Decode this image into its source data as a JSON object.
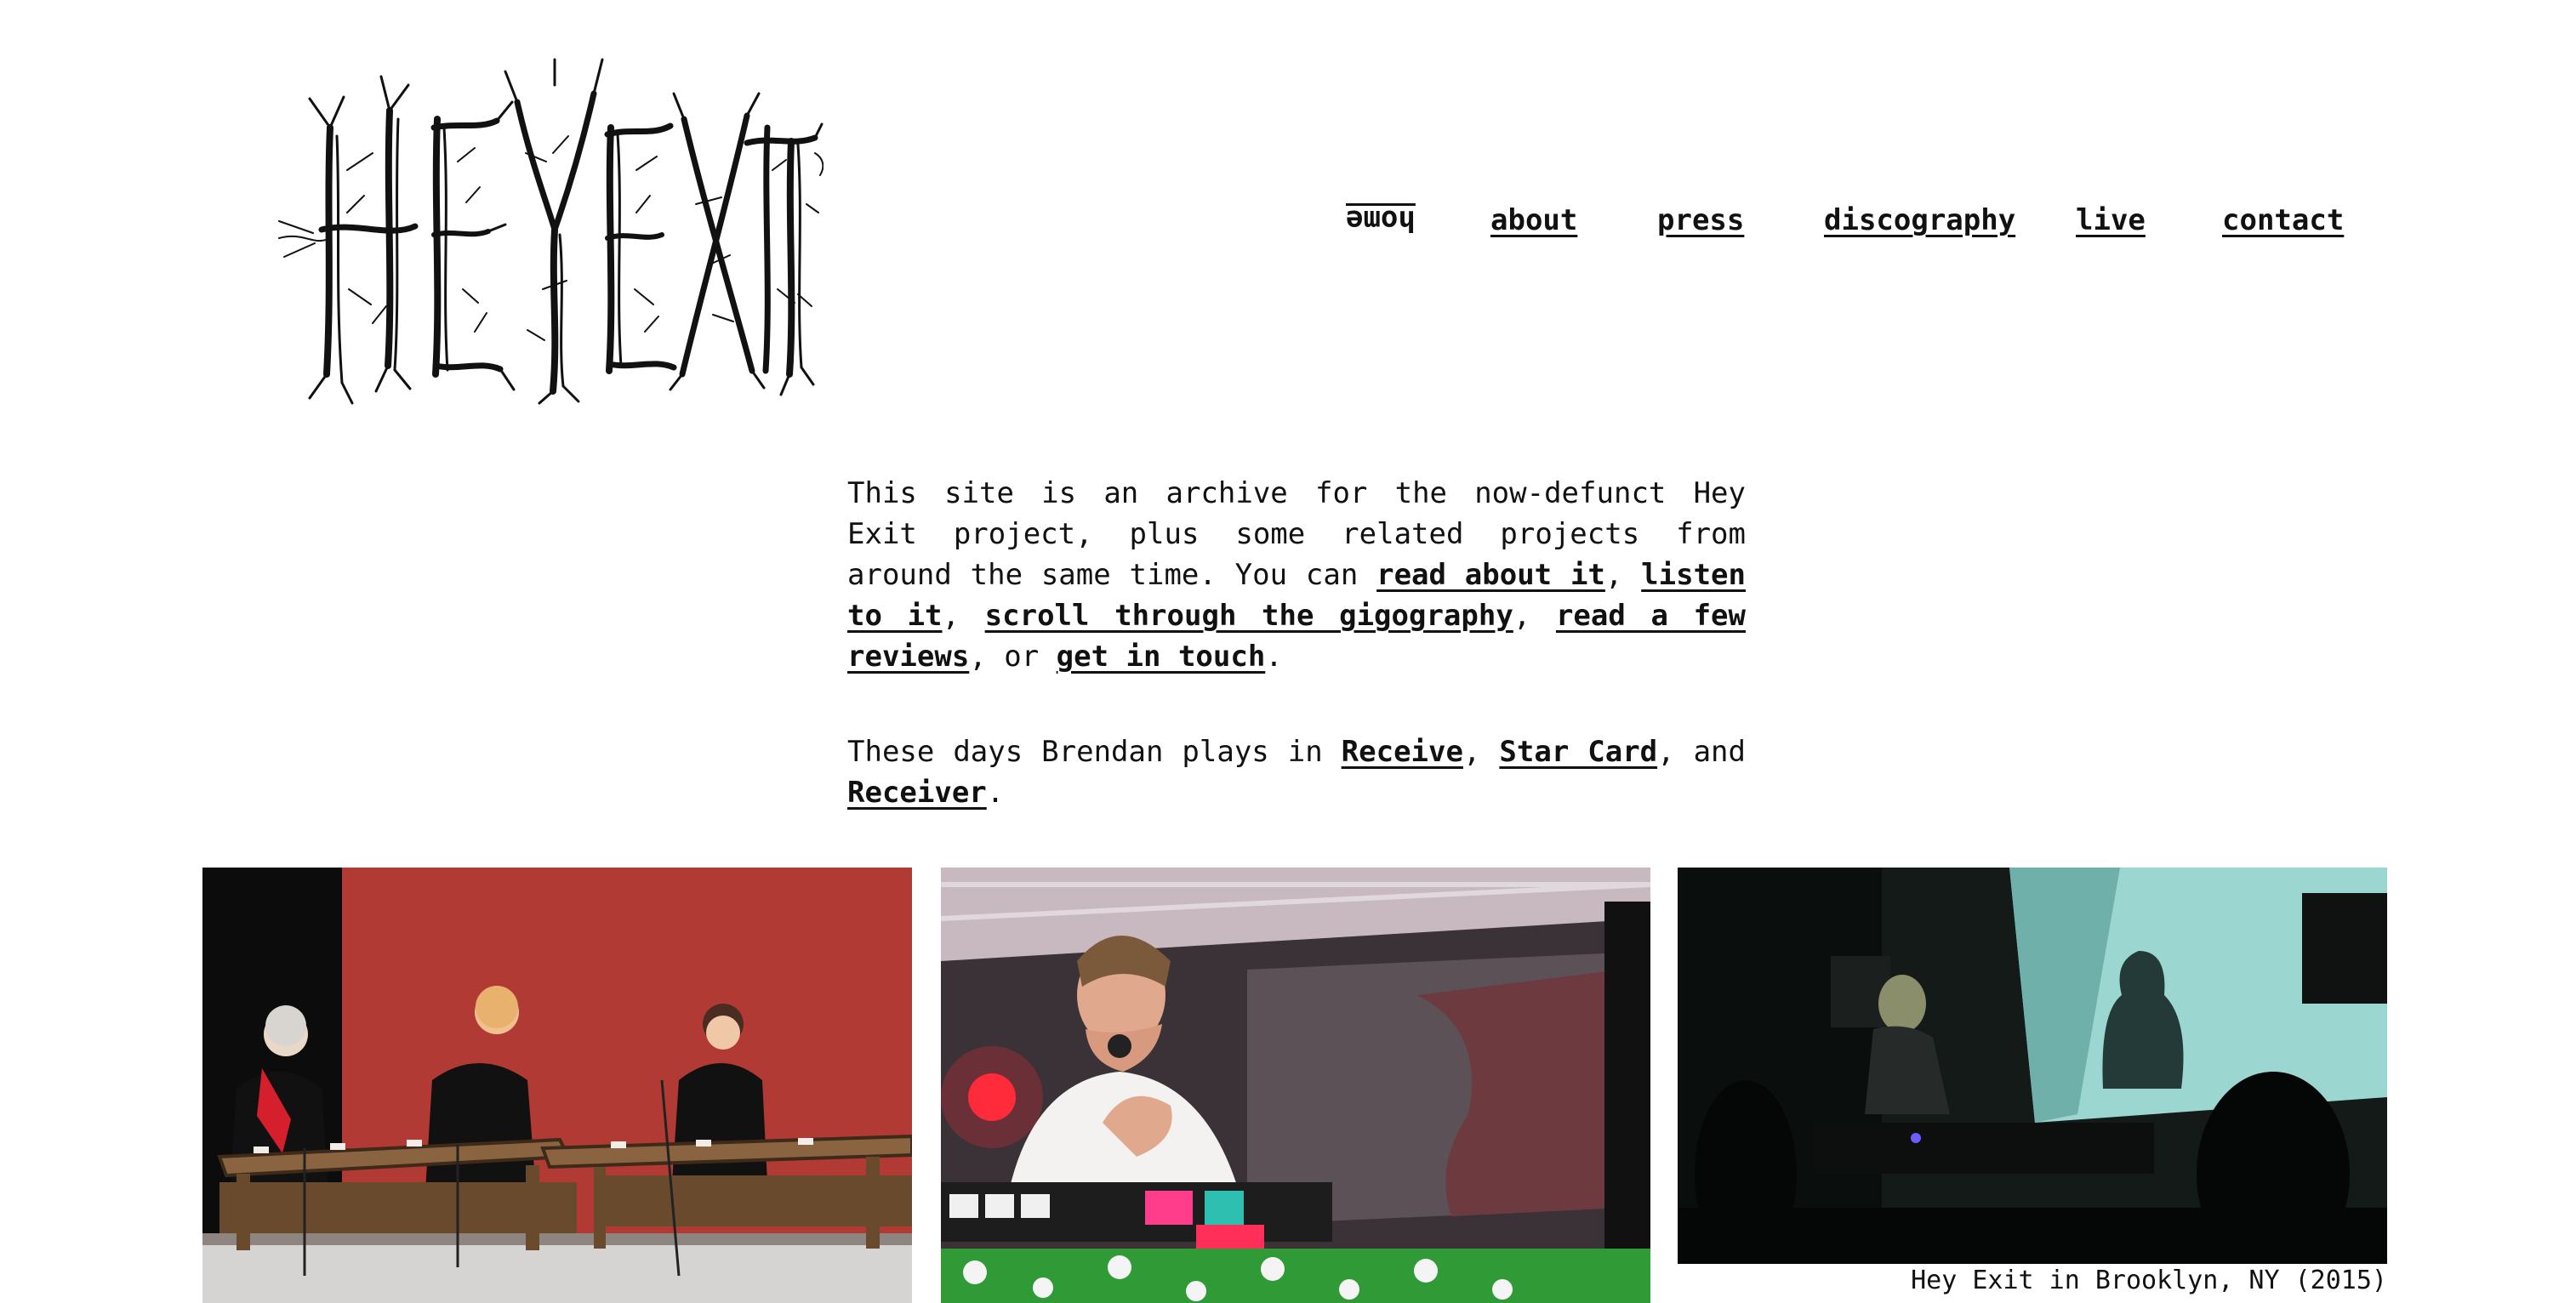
{
  "site": {
    "logo_text": "HEY EXIT"
  },
  "nav": {
    "items": [
      {
        "label": "home"
      },
      {
        "label": "about"
      },
      {
        "label": "press"
      },
      {
        "label": "discography"
      },
      {
        "label": "live"
      },
      {
        "label": "contact"
      }
    ]
  },
  "intro": {
    "p1": {
      "t1": "This site is an archive for the now-defunct Hey Exit project, plus some related projects from around the same time. You can ",
      "link_read": "read about it",
      "t2": ", ",
      "link_listen": "listen to it",
      "t3": ", ",
      "link_gigography": "scroll through the gigography",
      "t4": ", ",
      "link_reviews": "read a few reviews",
      "t5": ", or ",
      "link_touch": "get in touch",
      "t6": "."
    },
    "p2": {
      "t1": "These days Brendan plays in ",
      "link_receive": "Receive",
      "t2": ", ",
      "link_starcard": "Star Card",
      "t3": ", and ",
      "link_receiver": "Receiver",
      "t4": "."
    }
  },
  "gallery": {
    "caption": "Hey Exit in Brooklyn, NY (2015)"
  },
  "colors": {
    "text": "#111111",
    "background": "#ffffff",
    "stage_red": "#b13a34"
  }
}
